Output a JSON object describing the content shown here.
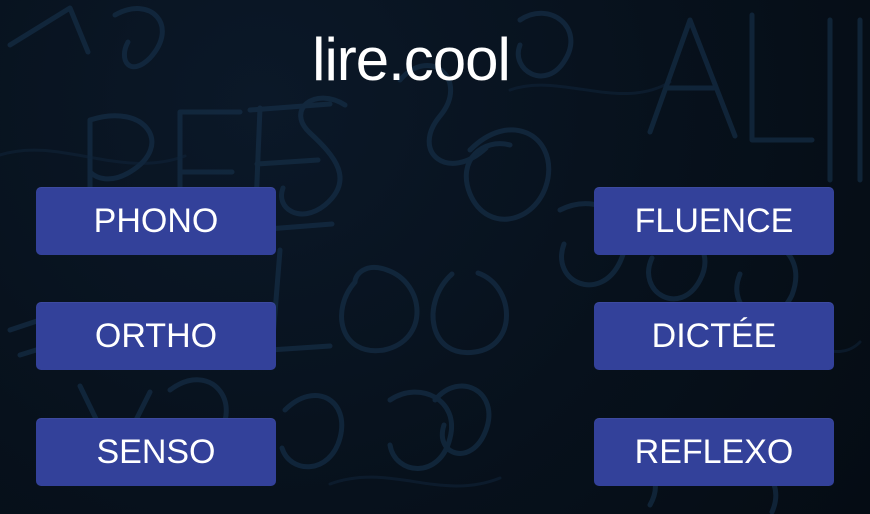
{
  "app": {
    "title": "lire.cool"
  },
  "menu": {
    "left": [
      {
        "label": "PHONO"
      },
      {
        "label": "ORTHO"
      },
      {
        "label": "SENSO"
      }
    ],
    "right": [
      {
        "label": "FLUENCE"
      },
      {
        "label": "DICTÉE"
      },
      {
        "label": "REFLEXO"
      }
    ]
  },
  "colors": {
    "background": "#07111c",
    "button": "#33419a",
    "text": "#ffffff",
    "decoration": "#163049"
  },
  "icons": {
    "background": "handwritten-letters-pattern"
  }
}
